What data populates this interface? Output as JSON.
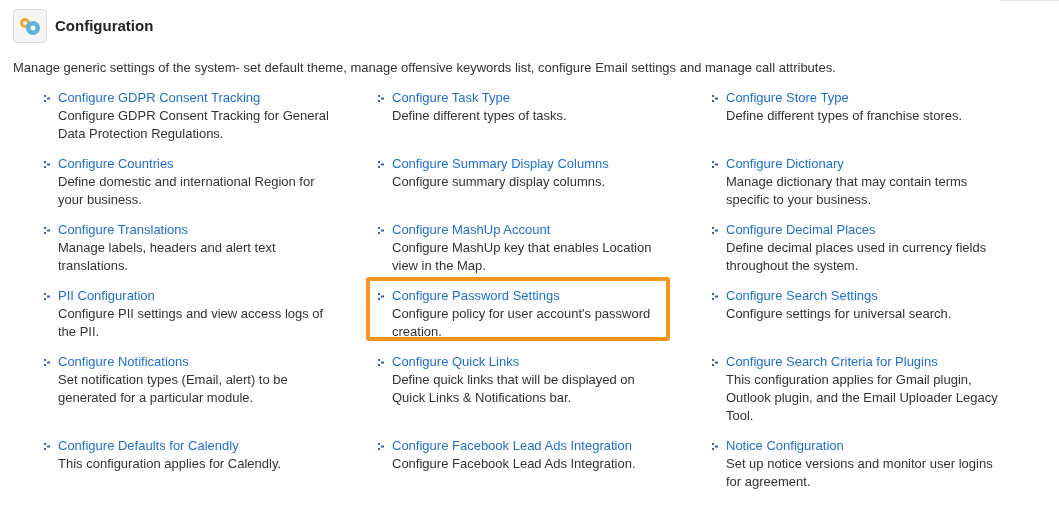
{
  "header": {
    "title": "Configuration"
  },
  "description": "Manage generic settings of the system- set default theme, manage offensive keywords list, configure Email settings and manage call attributes.",
  "items": [
    {
      "link": "Configure GDPR Consent Tracking",
      "text": "Configure GDPR Consent Tracking for General Data Protection Regulations.",
      "highlighted": false
    },
    {
      "link": "Configure Task Type",
      "text": "Define different types of tasks.",
      "highlighted": false
    },
    {
      "link": "Configure Store Type",
      "text": "Define different types of franchise stores.",
      "highlighted": false
    },
    {
      "link": "Configure Countries",
      "text": "Define domestic and international Region for your business.",
      "highlighted": false
    },
    {
      "link": "Configure Summary Display Columns",
      "text": "Configure summary display columns.",
      "highlighted": false
    },
    {
      "link": "Configure Dictionary",
      "text": "Manage dictionary that may contain terms specific to your business.",
      "highlighted": false
    },
    {
      "link": "Configure Translations",
      "text": "Manage labels, headers and alert text translations.",
      "highlighted": false
    },
    {
      "link": "Configure MashUp Account",
      "text": "Configure MashUp key that enables Location view in the Map.",
      "highlighted": false
    },
    {
      "link": "Configure Decimal Places",
      "text": "Define decimal places used in currency fields throughout the system.",
      "highlighted": false
    },
    {
      "link": "PII Configuration",
      "text": "Configure PII settings and view access logs of the PII.",
      "highlighted": false
    },
    {
      "link": "Configure Password Settings",
      "text": "Configure policy for user account's password creation.",
      "highlighted": true
    },
    {
      "link": "Configure Search Settings",
      "text": "Configure settings for universal search.",
      "highlighted": false
    },
    {
      "link": "Configure Notifications",
      "text": "Set notification types (Email, alert) to be generated for a particular module.",
      "highlighted": false
    },
    {
      "link": "Configure Quick Links",
      "text": "Define quick links that will be displayed on Quick Links & Notifications bar.",
      "highlighted": false
    },
    {
      "link": "Configure Search Criteria for Plugins",
      "text": "This configuration applies for Gmail plugin, Outlook plugin, and the Email Uploader Legacy Tool.",
      "highlighted": false
    },
    {
      "link": "Configure Defaults for Calendly",
      "text": "This configuration applies for Calendly.",
      "highlighted": false
    },
    {
      "link": "Configure Facebook Lead Ads Integration",
      "text": "Configure Facebook Lead Ads Integration.",
      "highlighted": false
    },
    {
      "link": "Notice Configuration",
      "text": "Set up notice versions and monitor user logins for agreement.",
      "highlighted": false
    }
  ]
}
